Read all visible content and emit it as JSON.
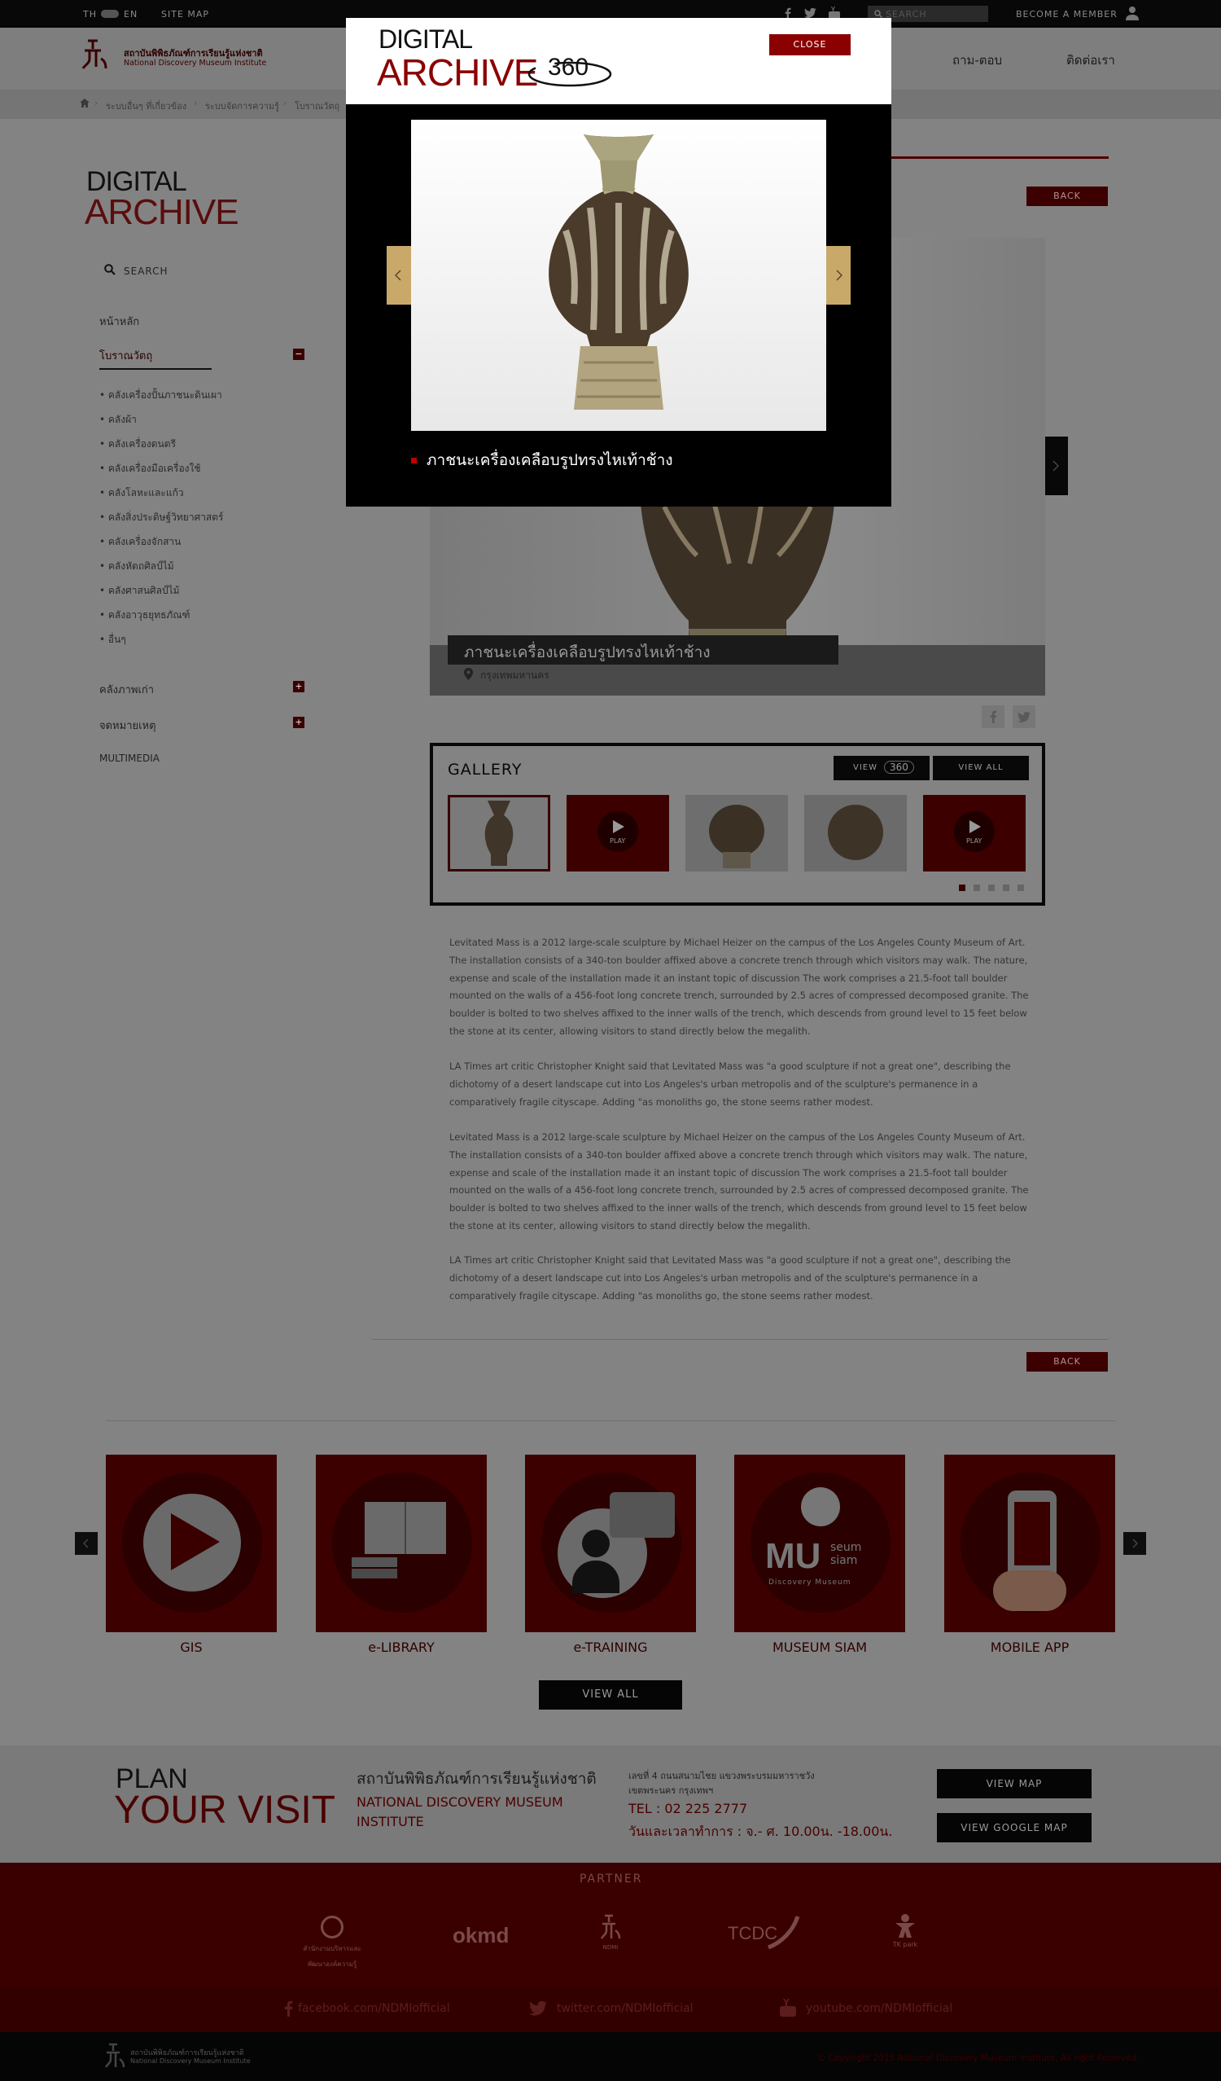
{
  "topbar": {
    "lang_th": "TH",
    "lang_en": "EN",
    "sitemap": "SITE MAP",
    "search_placeholder": "SEARCH",
    "member": "BECOME A MEMBER"
  },
  "header": {
    "logo_th": "สถาบันพิพิธภัณฑ์การเรียนรู้แห่งชาติ",
    "logo_en": "National Discovery Museum Institute",
    "nav": [
      "ถาม-ตอบ",
      "ติดต่อเรา"
    ]
  },
  "breadcrumb": [
    "ระบบอื่นๆ ที่เกี่ยวข้อง",
    "ระบบจัดการความรู้",
    "โบราณวัตถุ"
  ],
  "sidebar": {
    "title_1": "DIGITAL",
    "title_2": "ARCHIVE",
    "search": "SEARCH",
    "home": "หน้าหลัก",
    "section_active": "โบราณวัตถุ",
    "sub_items": [
      "คลังเครื่องปั้นภาชนะดินเผา",
      "คลังผ้า",
      "คลังเครื่องดนตรี",
      "คลังเครื่องมือเครื่องใช้",
      "คลังโลหะและแก้ว",
      "คลังสิ่งประดิษฐ์วิทยาศาสตร์",
      "คลังเครื่องจักสาน",
      "คลังหัตถศิลป์ไม้",
      "คลังศาสนศิลป์ไม้",
      "คลังอาวุธยุทธภัณฑ์",
      "อื่นๆ"
    ],
    "section_photo": "คลังภาพเก่า",
    "section_docs": "จดหมายเหตุ",
    "multimedia": "MULTIMEDIA"
  },
  "main": {
    "back_label": "BACK",
    "object_title": "ภาชนะเครื่องเคลือบรูปทรงไหเท้าช้าง",
    "location": "กรุงเทพมหานคร",
    "gallery_title": "GALLERY",
    "view_360": "VIEW",
    "view_360_badge": "360",
    "view_all": "VIEW ALL",
    "play": "PLAY",
    "paragraphs": [
      "Levitated Mass is a 2012 large-scale sculpture by Michael Heizer on the campus of the Los Angeles County Museum of Art. The installation consists of a 340-ton boulder affixed above a concrete trench through which visitors may walk. The nature, expense and scale of the installation made it an instant topic of discussion The work comprises a 21.5-foot tall boulder mounted on the walls of a 456-foot long concrete trench, surrounded by 2.5 acres of compressed decomposed granite. The boulder is bolted to two shelves affixed to the inner walls of the trench, which descends from ground level to 15 feet below the stone at its center, allowing visitors to stand directly below the megalith.",
      "LA Times art critic Christopher Knight said that Levitated Mass was \"a good sculpture if not a great one\", describing the dichotomy of a desert landscape cut into Los Angeles's urban metropolis and of the sculpture's permanence in a comparatively fragile cityscape. Adding \"as monoliths go, the stone seems rather modest.",
      "Levitated Mass is a 2012 large-scale sculpture by Michael Heizer on the campus of the Los Angeles County Museum of Art. The installation consists of a 340-ton boulder affixed above a concrete trench through which visitors may walk. The nature, expense and scale of the installation made it an instant topic of discussion The work comprises a 21.5-foot tall boulder mounted on the walls of a 456-foot long concrete trench, surrounded by 2.5 acres of compressed decomposed granite. The boulder is bolted to two shelves affixed to the inner walls of the trench, which descends from ground level to 15 feet below the stone at its center, allowing visitors to stand directly below the megalith.",
      "LA Times art critic Christopher Knight said that Levitated Mass was \"a good sculpture if not a great one\", describing the dichotomy of a desert landscape cut into Los Angeles's urban metropolis and of the sculpture's permanence in a comparatively fragile cityscape. Adding \"as monoliths go, the stone seems rather modest."
    ]
  },
  "services": {
    "items": [
      "GIS",
      "e-LIBRARY",
      "e-TRAINING",
      "MUSEUM SIAM",
      "MOBILE APP"
    ],
    "museum_siam_logo_text": [
      "MU",
      "seum",
      "siam",
      "Discovery Museum"
    ],
    "view_all": "VIEW ALL"
  },
  "plan": {
    "title_1": "PLAN",
    "title_2": "YOUR VISIT",
    "org_th": "สถาบันพิพิธภัณฑ์การเรียนรู้แห่งชาติ",
    "org_en_1": "NATIONAL DISCOVERY MUSEUM",
    "org_en_2": "INSTITUTE",
    "address_1": "เลขที่ 4 ถนนสนามไชย แขวงพระบรมมหาราชวัง",
    "address_2": "เขตพระนคร กรุงเทพฯ",
    "tel": "TEL : 02 225 2777",
    "hours": "วันและเวลาทำการ : จ.- ศ. 10.00น. -18.00น.",
    "view_map": "VIEW MAP",
    "view_google_map": "VIEW GOOGLE MAP"
  },
  "partner": {
    "title": "PARTNER",
    "logos": [
      "สำนักงานบริหารและพัฒนาองค์ความรู้",
      "okmd",
      "NDMI",
      "TCDC",
      "TK park"
    ]
  },
  "social": {
    "facebook": "facebook.com/NDMIofficial",
    "twitter": "twitter.com/NDMIofficial",
    "youtube": "youtube.com/NDMIofficial"
  },
  "footer": {
    "logo_th": "สถาบันพิพิธภัณฑ์การเรียนรู้แห่งชาติ",
    "logo_en": "National Discovery Museum Institute",
    "copyright": "© Copyright 2015 National Discovery Museum Institute, All right Reserved."
  },
  "modal": {
    "title_1": "DIGITAL",
    "title_2": "ARCHIVE",
    "badge": "360",
    "close": "CLOSE",
    "caption": "ภาชนะเครื่องเคลือบรูปทรงไหเท้าช้าง"
  },
  "colors": {
    "brand_red": "#8b0000",
    "dark_red": "#3a0000",
    "overlay": "#838383",
    "gold_arrow": "#c8a96a"
  }
}
